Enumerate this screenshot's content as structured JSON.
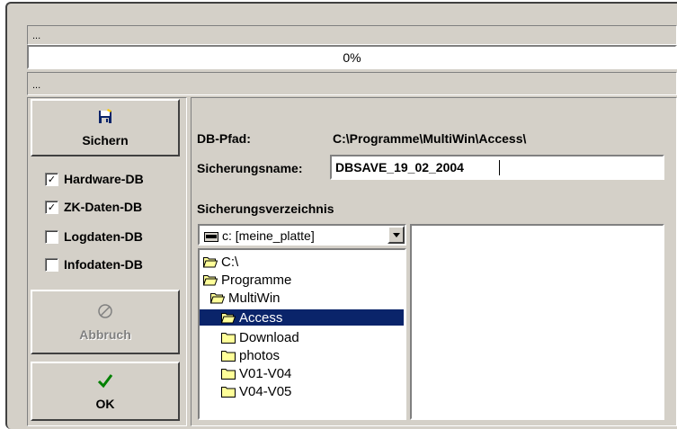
{
  "top": {
    "status_top": "...",
    "progress_text": "0%",
    "status_bottom": "..."
  },
  "buttons": {
    "save_label": "Sichern",
    "cancel_label": "Abbruch",
    "ok_label": "OK"
  },
  "checkboxes": [
    {
      "label": "Hardware-DB",
      "checked": true
    },
    {
      "label": "ZK-Daten-DB",
      "checked": true
    },
    {
      "label": "Logdaten-DB",
      "checked": false
    },
    {
      "label": "Infodaten-DB",
      "checked": false
    }
  ],
  "form": {
    "db_path_label": "DB-Pfad:",
    "db_path_value": "C:\\Programme\\MultiWin\\Access\\",
    "backup_name_label": "Sicherungsname:",
    "backup_name_value": "DBSAVE_19_02_2004",
    "backup_dir_label": "Sicherungsverzeichnis"
  },
  "drive": {
    "selected": "c: [meine_platte]"
  },
  "tree": {
    "items": [
      {
        "label": "C:\\",
        "state": "open"
      },
      {
        "label": "Programme",
        "state": "open"
      },
      {
        "label": "MultiWin",
        "state": "open"
      },
      {
        "label": "Access",
        "state": "selected"
      },
      {
        "label": "Download",
        "state": "closed"
      },
      {
        "label": "photos",
        "state": "closed"
      },
      {
        "label": "V01-V04",
        "state": "closed"
      },
      {
        "label": "V04-V05",
        "state": "closed"
      }
    ]
  },
  "colors": {
    "face": "#d4d0c8",
    "selection": "#0a246a",
    "folder": "#ffff99"
  }
}
